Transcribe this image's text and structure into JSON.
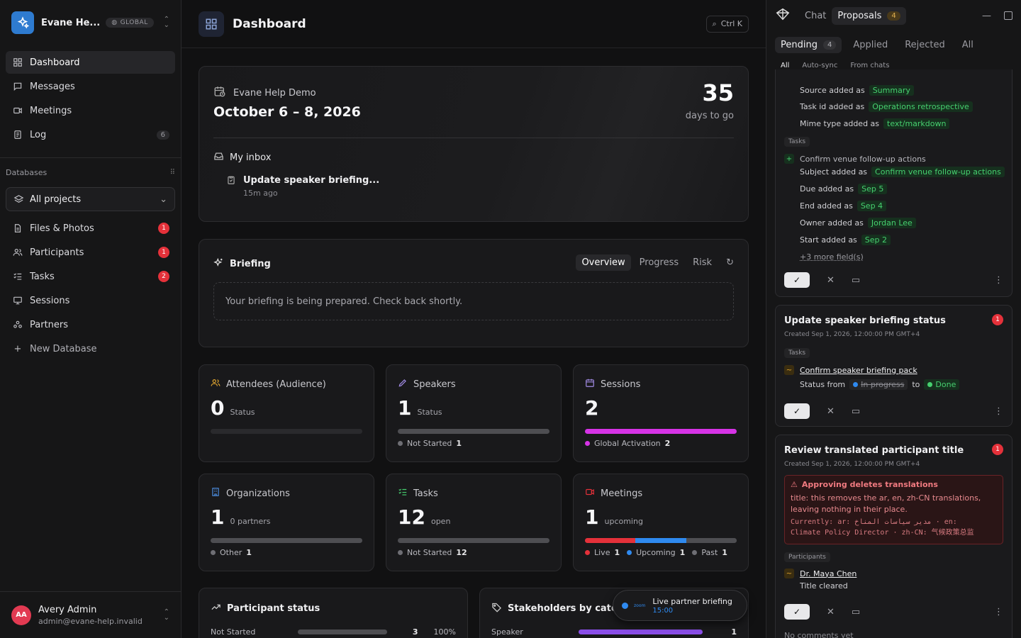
{
  "workspace": {
    "name": "Evane He...",
    "badge": "GLOBAL"
  },
  "nav": [
    {
      "label": "Dashboard",
      "icon": "dashboard-icon"
    },
    {
      "label": "Messages",
      "icon": "message-icon"
    },
    {
      "label": "Meetings",
      "icon": "video-icon"
    },
    {
      "label": "Log",
      "icon": "log-icon",
      "count": "6"
    }
  ],
  "databases": {
    "heading": "Databases",
    "project_select": "All projects",
    "items": [
      {
        "label": "Files & Photos",
        "count": "1"
      },
      {
        "label": "Participants",
        "count": "1"
      },
      {
        "label": "Tasks",
        "count": "2"
      },
      {
        "label": "Sessions"
      },
      {
        "label": "Partners"
      }
    ],
    "new_label": "New Database"
  },
  "user": {
    "initials": "AA",
    "name": "Avery Admin",
    "email": "admin@evane-help.invalid"
  },
  "header": {
    "title": "Dashboard",
    "search_shortcut": "Ctrl K"
  },
  "event": {
    "org": "Evane Help Demo",
    "dates": "October 6 – 8, 2026",
    "countdown": "35",
    "countdown_label": "days to go",
    "inbox_title": "My inbox",
    "inbox_item_title": "Update speaker briefing...",
    "inbox_item_time": "15m ago"
  },
  "briefing": {
    "title": "Briefing",
    "tabs": [
      "Overview",
      "Progress",
      "Risk"
    ],
    "message": "Your briefing is being prepared. Check back shortly."
  },
  "stats": {
    "attendees": {
      "title": "Attendees (Audience)",
      "value": "0",
      "sub": "Status"
    },
    "speakers": {
      "title": "Speakers",
      "value": "1",
      "sub": "Status",
      "legend": [
        {
          "label": "Not Started",
          "value": "1"
        }
      ]
    },
    "sessions": {
      "title": "Sessions",
      "value": "2",
      "legend": [
        {
          "label": "Global Activation",
          "value": "2"
        }
      ]
    },
    "organizations": {
      "title": "Organizations",
      "value": "1",
      "sub": "0 partners",
      "legend": [
        {
          "label": "Other",
          "value": "1"
        }
      ]
    },
    "tasks": {
      "title": "Tasks",
      "value": "12",
      "sub": "open",
      "legend": [
        {
          "label": "Not Started",
          "value": "12"
        }
      ]
    },
    "meetings": {
      "title": "Meetings",
      "value": "1",
      "sub": "upcoming",
      "legend": [
        {
          "label": "Live",
          "value": "1"
        },
        {
          "label": "Upcoming",
          "value": "1"
        },
        {
          "label": "Past",
          "value": "1"
        }
      ]
    }
  },
  "participant_status": {
    "title": "Participant status",
    "row_label": "Not Started",
    "row_value": "3",
    "row_pct": "100%"
  },
  "stakeholders": {
    "title": "Stakeholders by categ",
    "row_label": "Speaker",
    "row_value": "1"
  },
  "toast": {
    "title": "Live partner briefing",
    "time": "15:00",
    "logo": "zoom"
  },
  "panel": {
    "tabs": {
      "chat": "Chat",
      "proposals": "Proposals",
      "proposals_count": "4"
    },
    "filters": {
      "pending": "Pending",
      "pending_count": "4",
      "applied": "Applied",
      "rejected": "Rejected",
      "all": "All"
    },
    "sub_filters": [
      "All",
      "Auto-sync",
      "From chats"
    ],
    "card1": {
      "fields_top": [
        {
          "label": "Source added as",
          "value": "Summary"
        },
        {
          "label": "Task id added as",
          "value": "Operations retrospective"
        },
        {
          "label": "Mime type added as",
          "value": "text/markdown"
        }
      ],
      "section": "Tasks",
      "new_item": "Confirm venue follow-up actions",
      "fields": [
        {
          "label": "Subject added as",
          "value": "Confirm venue follow-up actions"
        },
        {
          "label": "Due added as",
          "value": "Sep 5"
        },
        {
          "label": "End added as",
          "value": "Sep 4"
        },
        {
          "label": "Owner added as",
          "value": "Jordan Lee"
        },
        {
          "label": "Start added as",
          "value": "Sep 2"
        }
      ],
      "more": "+3 more field(s)"
    },
    "card2": {
      "title": "Update speaker briefing status",
      "meta": "Created Sep 1, 2026, 12:00:00 PM GMT+4",
      "badge": "1",
      "section": "Tasks",
      "item": "Confirm speaker briefing pack",
      "status_from_label": "Status from",
      "status_from": "In progress",
      "to_label": "to",
      "status_to": "Done"
    },
    "card3": {
      "title": "Review translated participant title",
      "meta": "Created Sep 1, 2026, 12:00:00 PM GMT+4",
      "badge": "1",
      "warn_title": "Approving deletes translations",
      "warn_text": "title: this removes the ar, en, zh-CN translations, leaving nothing in their place.",
      "warn_mono1": "Currently: ar: مدير سياسات المناخ · en:",
      "warn_mono2": "Climate Policy Director · zh-CN: 气候政策总监",
      "section": "Participants",
      "item": "Dr. Maya Chen",
      "field": "Title cleared"
    },
    "footer_text": "No comments yet"
  },
  "colors": {
    "accent_magenta": "#d633e6",
    "accent_blue": "#2f8af0",
    "live_red": "#e5313a",
    "success_green": "#46d06f"
  }
}
